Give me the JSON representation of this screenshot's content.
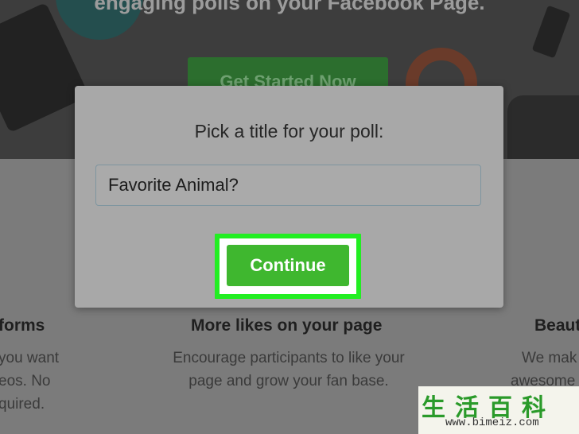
{
  "background_page": {
    "tagline": "engaging polls on your Facebook Page.",
    "cta_label": "Get Started Now",
    "features": [
      {
        "title": "forms",
        "lines": [
          "you want",
          "eos. No",
          "quired."
        ]
      },
      {
        "title": "More likes on your page",
        "lines": [
          "Encourage participants to like your",
          "page and grow your fan base."
        ]
      },
      {
        "title": "Beaut",
        "lines": [
          "We mak",
          "awesome"
        ]
      }
    ]
  },
  "modal": {
    "title": "Pick a title for your poll:",
    "input_value": "Favorite Animal?",
    "continue_label": "Continue"
  },
  "watermark": {
    "chars": [
      "生",
      "活",
      "百",
      "科"
    ],
    "url": "www.bimeiz.com"
  },
  "colors": {
    "accent_green": "#3fb72f",
    "highlight_border": "#22ee22"
  }
}
